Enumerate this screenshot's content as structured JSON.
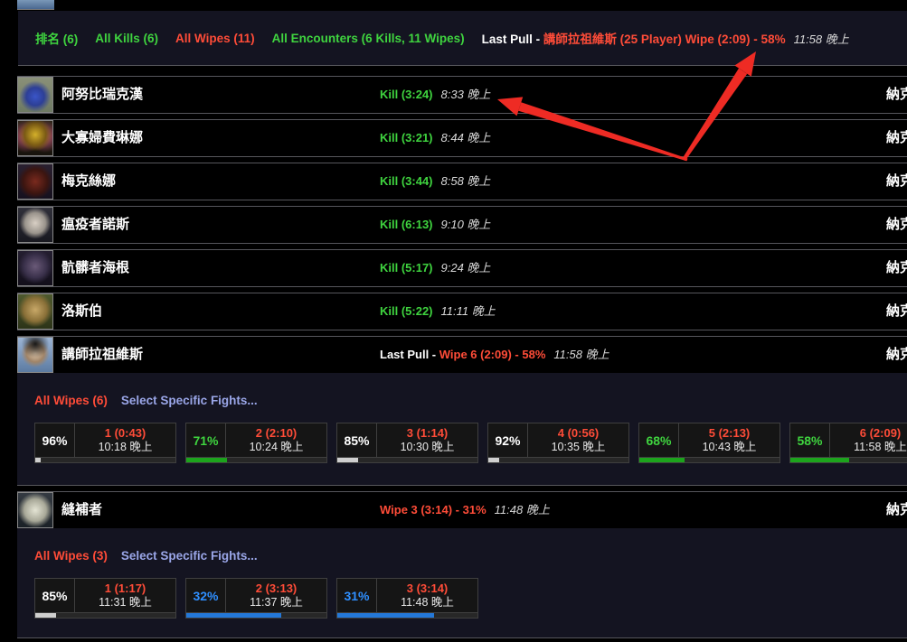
{
  "theme": {
    "green": "#3fd43f",
    "red": "#ff4c38",
    "blue": "#2f8fff",
    "link_lavender": "#9aa6e8",
    "panel_bg": "#141421",
    "arrow_red": "#ee2b24"
  },
  "zone_label": "納克薩瑪斯",
  "filter_bar": {
    "items": [
      {
        "label": "排名 (6)",
        "tone": "green"
      },
      {
        "label": "All Kills (6)",
        "tone": "green"
      },
      {
        "label": "All Wipes (11)",
        "tone": "red"
      },
      {
        "label": "All Encounters (6 Kills, 11 Wipes)",
        "tone": "green"
      }
    ],
    "last_pull_prefix": "Last Pull - ",
    "last_pull_detail": "講師拉祖維斯 (25 Player) Wipe (2:09) - 58%",
    "last_pull_time": "11:58 晚上"
  },
  "encounters": [
    {
      "name": "阿努比瑞克漢",
      "status": "Kill (3:24)",
      "tone": "green",
      "time": "8:33 晚上",
      "status_prefix": ""
    },
    {
      "name": "大寡婦費琳娜",
      "status": "Kill (3:21)",
      "tone": "green",
      "time": "8:44 晚上",
      "status_prefix": ""
    },
    {
      "name": "梅克絲娜",
      "status": "Kill (3:44)",
      "tone": "green",
      "time": "8:58 晚上",
      "status_prefix": ""
    },
    {
      "name": "瘟疫者諾斯",
      "status": "Kill (6:13)",
      "tone": "green",
      "time": "9:10 晚上",
      "status_prefix": ""
    },
    {
      "name": "骯髒者海根",
      "status": "Kill (5:17)",
      "tone": "green",
      "time": "9:24 晚上",
      "status_prefix": ""
    },
    {
      "name": "洛斯伯",
      "status": "Kill (5:22)",
      "tone": "green",
      "time": "11:11 晚上",
      "status_prefix": ""
    },
    {
      "name": "講師拉祖維斯",
      "status": "Wipe 6 (2:09) - 58%",
      "tone": "red",
      "time": "11:58 晚上",
      "status_prefix": "Last Pull - "
    },
    {
      "name": "縫補者",
      "status": "Wipe 3 (3:14) - 31%",
      "tone": "red",
      "time": "11:48 晚上",
      "status_prefix": ""
    }
  ],
  "razuvious_panel": {
    "all_wipes_label": "All Wipes (6)",
    "select_label": "Select Specific Fights...",
    "pulls": [
      {
        "pct": "96%",
        "tone": "white",
        "label": "1 (0:43)",
        "time": "10:18 晚上",
        "bar_pct": 4
      },
      {
        "pct": "71%",
        "tone": "green",
        "label": "2 (2:10)",
        "time": "10:24 晚上",
        "bar_pct": 29
      },
      {
        "pct": "85%",
        "tone": "white",
        "label": "3 (1:14)",
        "time": "10:30 晚上",
        "bar_pct": 15
      },
      {
        "pct": "92%",
        "tone": "white",
        "label": "4 (0:56)",
        "time": "10:35 晚上",
        "bar_pct": 8
      },
      {
        "pct": "68%",
        "tone": "green",
        "label": "5 (2:13)",
        "time": "10:43 晚上",
        "bar_pct": 32
      },
      {
        "pct": "58%",
        "tone": "green",
        "label": "6 (2:09)",
        "time": "11:58 晚上",
        "bar_pct": 42
      }
    ]
  },
  "patchwerk_panel": {
    "all_wipes_label": "All Wipes (3)",
    "select_label": "Select Specific Fights...",
    "pulls": [
      {
        "pct": "85%",
        "tone": "white",
        "label": "1 (1:17)",
        "time": "11:31 晚上",
        "bar_pct": 15
      },
      {
        "pct": "32%",
        "tone": "blue",
        "label": "2 (3:13)",
        "time": "11:37 晚上",
        "bar_pct": 68
      },
      {
        "pct": "31%",
        "tone": "blue",
        "label": "3 (3:14)",
        "time": "11:48 晚上",
        "bar_pct": 69
      }
    ]
  }
}
